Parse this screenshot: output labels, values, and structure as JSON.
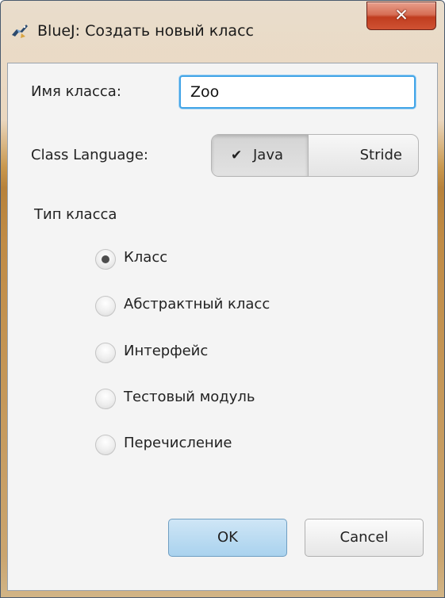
{
  "window": {
    "title": "BlueJ: Создать новый класс",
    "close_icon": "close-icon",
    "app_icon": "bluej-bird-icon"
  },
  "form": {
    "class_name_label": "Имя класса:",
    "class_name_value": "Zoo",
    "class_language_label": "Class Language:",
    "languages": [
      {
        "label": "Java",
        "selected": true
      },
      {
        "label": "Stride",
        "selected": false
      }
    ],
    "selected_check_icon": "checkmark-icon",
    "class_type_label": "Тип класса",
    "class_types": [
      {
        "label": "Класс",
        "selected": true
      },
      {
        "label": "Абстрактный класс",
        "selected": false
      },
      {
        "label": "Интерфейс",
        "selected": false
      },
      {
        "label": "Тестовый модуль",
        "selected": false
      },
      {
        "label": "Перечисление",
        "selected": false
      }
    ]
  },
  "buttons": {
    "ok_label": "OK",
    "cancel_label": "Cancel"
  },
  "colors": {
    "accent_focus": "#43a5e7",
    "ok_button": "#a9d2ee",
    "close_button": "#c03d1f"
  }
}
